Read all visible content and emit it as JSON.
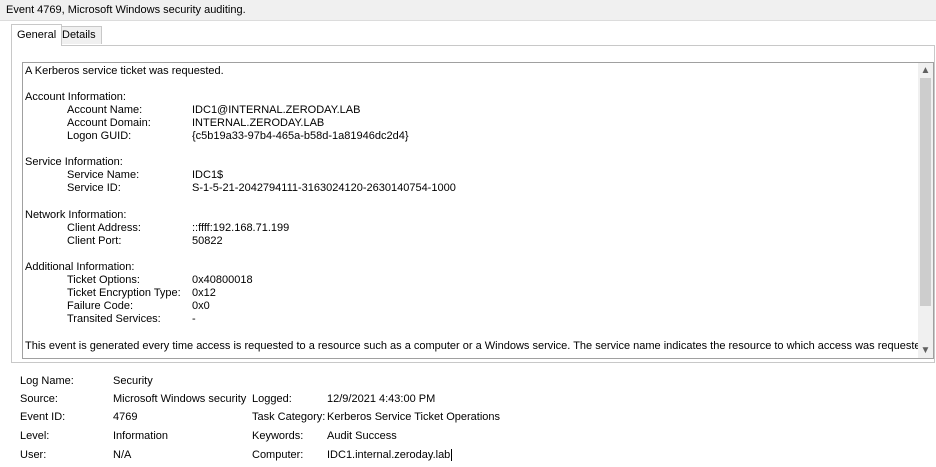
{
  "title": "Event 4769, Microsoft Windows security auditing.",
  "tabs": [
    {
      "label": "General",
      "active": true
    },
    {
      "label": "Details",
      "active": false
    }
  ],
  "message": {
    "intro": "A Kerberos service ticket was requested.",
    "account_header": "Account Information:",
    "account": [
      {
        "label": "Account Name:",
        "value": "IDC1@INTERNAL.ZERODAY.LAB"
      },
      {
        "label": "Account Domain:",
        "value": "INTERNAL.ZERODAY.LAB"
      },
      {
        "label": "Logon GUID:",
        "value": "{c5b19a33-97b4-465a-b58d-1a81946dc2d4}"
      }
    ],
    "service_header": "Service Information:",
    "service": [
      {
        "label": "Service Name:",
        "value": "IDC1$"
      },
      {
        "label": "Service ID:",
        "value": "S-1-5-21-2042794111-3163024120-2630140754-1000"
      }
    ],
    "network_header": "Network Information:",
    "network": [
      {
        "label": "Client Address:",
        "value": "::ffff:192.168.71.199"
      },
      {
        "label": "Client Port:",
        "value": "50822"
      }
    ],
    "additional_header": "Additional Information:",
    "additional": [
      {
        "label": "Ticket Options:",
        "value": "0x40800018"
      },
      {
        "label": "Ticket Encryption Type:",
        "value": "0x12"
      },
      {
        "label": "Failure Code:",
        "value": "0x0"
      },
      {
        "label": "Transited Services:",
        "value": "-"
      }
    ],
    "footer": "This event is generated every time access is requested to a resource such as a computer or a Windows service.  The service name indicates the resource to which access was requested."
  },
  "details": {
    "log_name": {
      "label": "Log Name:",
      "value": "Security"
    },
    "source": {
      "label": "Source:",
      "value": "Microsoft Windows security"
    },
    "logged": {
      "label": "Logged:",
      "value": "12/9/2021 4:43:00 PM"
    },
    "event_id": {
      "label": "Event ID:",
      "value": "4769"
    },
    "task_category": {
      "label": "Task Category:",
      "value": "Kerberos Service Ticket Operations"
    },
    "level": {
      "label": "Level:",
      "value": "Information"
    },
    "keywords": {
      "label": "Keywords:",
      "value": "Audit Success"
    },
    "user": {
      "label": "User:",
      "value": "N/A"
    },
    "computer": {
      "label": "Computer:",
      "value": "IDC1.internal.zeroday.lab"
    }
  }
}
